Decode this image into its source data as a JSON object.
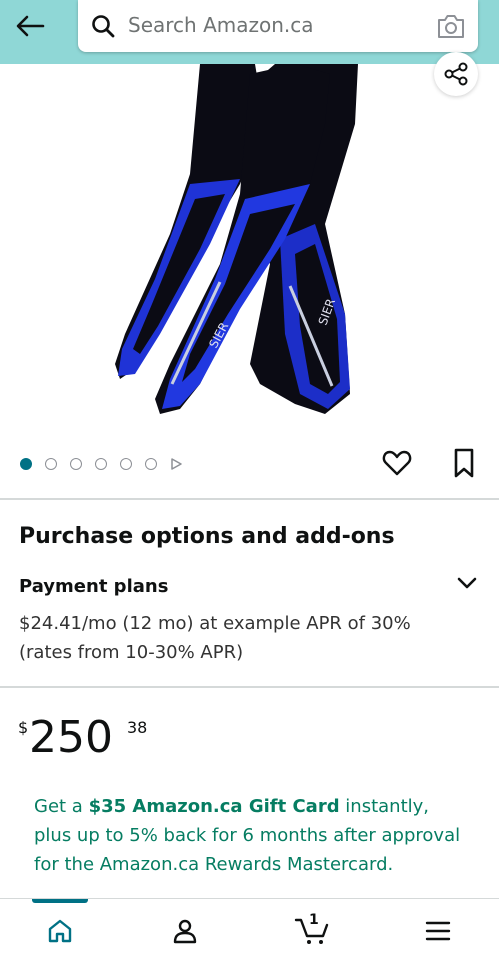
{
  "header": {
    "search_placeholder": "Search Amazon.ca",
    "back_icon": "arrow-left-icon",
    "camera_icon": "camera-icon",
    "background_color": "#8fd7d6"
  },
  "product": {
    "image_brand_text": "SIER",
    "image_count": 6,
    "current_image": 1
  },
  "purchase": {
    "section_title": "Purchase options and add-ons",
    "payment_title": "Payment plans",
    "payment_desc": "$24.41/mo (12 mo) at example APR of 30% (rates from 10-30% APR)"
  },
  "price": {
    "symbol": "$",
    "whole": "250",
    "fraction": "38"
  },
  "promo": {
    "prefix": "Get a ",
    "highlight": "$35 Amazon.ca Gift Card",
    "suffix": " instantly, plus up to 5% back for 6 months after approval for the Amazon.ca Rewards Mastercard."
  },
  "bottom_nav": {
    "cart_count": "1",
    "accent_color": "#007185"
  }
}
